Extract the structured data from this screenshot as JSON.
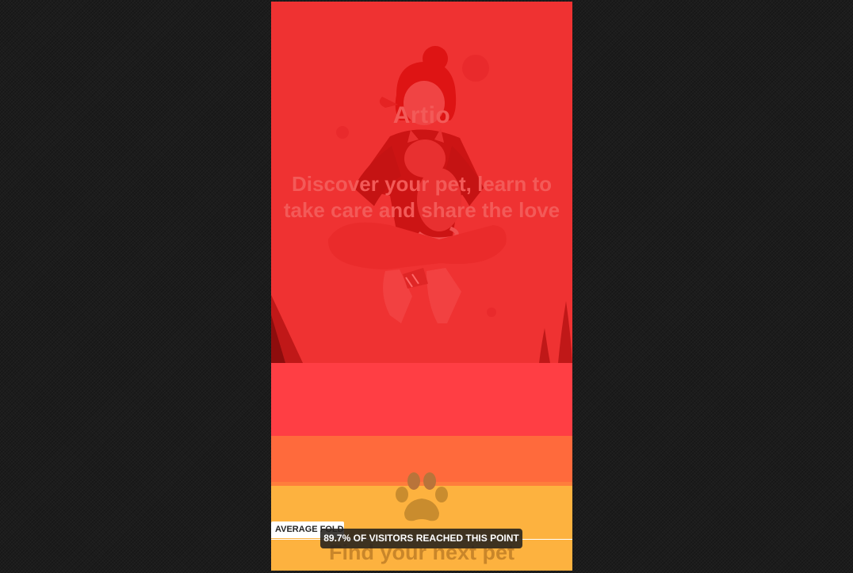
{
  "page": {
    "brand": "Artio",
    "tagline": "Discover your pet, learn to take care and share the love",
    "section_heading": "Find your next pet"
  },
  "overlay": {
    "fold_label": "AVERAGE FOLD",
    "visitors_text": "89.7% OF VISITORS REACHED THIS POINT",
    "visitors_reached_percent": 89.7
  },
  "icons": {
    "paw": "paw-icon",
    "hero": "woman-holding-cat-illustration"
  },
  "colors": {
    "hero_red": "#ef3232",
    "band_red": "#ff3e44",
    "band_orange": "#ff6a3c",
    "band_yellow": "#fdb23f",
    "viewer_background": "#1c1c1c"
  }
}
